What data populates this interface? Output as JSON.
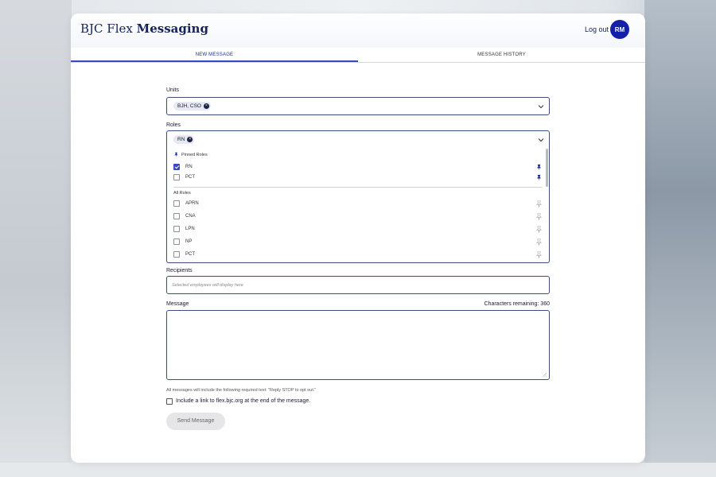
{
  "header": {
    "brand_light": "BJC Flex",
    "brand_bold": "Messaging",
    "logout_label": "Log out",
    "avatar_initials": "RM"
  },
  "tabs": [
    {
      "label": "NEW MESSAGE",
      "active": true
    },
    {
      "label": "MESSAGE HISTORY",
      "active": false
    }
  ],
  "form": {
    "units": {
      "label": "Units",
      "selected": [
        "BJH, CSO"
      ]
    },
    "roles": {
      "label": "Roles",
      "selected": [
        "RN"
      ],
      "dropdown": {
        "pinned_title": "Pinned Roles",
        "pinned": [
          {
            "label": "RN",
            "checked": true
          },
          {
            "label": "PCT",
            "checked": false
          }
        ],
        "all_title": "All Roles",
        "all": [
          {
            "label": "APRN",
            "checked": false
          },
          {
            "label": "CNA",
            "checked": false
          },
          {
            "label": "LPN",
            "checked": false
          },
          {
            "label": "NP",
            "checked": false
          },
          {
            "label": "PCT",
            "checked": false
          }
        ]
      }
    },
    "recipients": {
      "label": "Recipients",
      "placeholder": "Selected employees will display here"
    },
    "message": {
      "label": "Message",
      "chars_remaining": "Characters remaining: 360",
      "value": ""
    },
    "required_note": "All messages will include the following required text: \"Reply STOP to opt out.\"",
    "link_option": {
      "label": "Include a link to flex.bjc.org at the end of the message.",
      "checked": false
    },
    "send_label": "Send Message"
  },
  "colors": {
    "primary": "#1420a8",
    "accent": "#3b46c8",
    "brand_text": "#14235a"
  }
}
